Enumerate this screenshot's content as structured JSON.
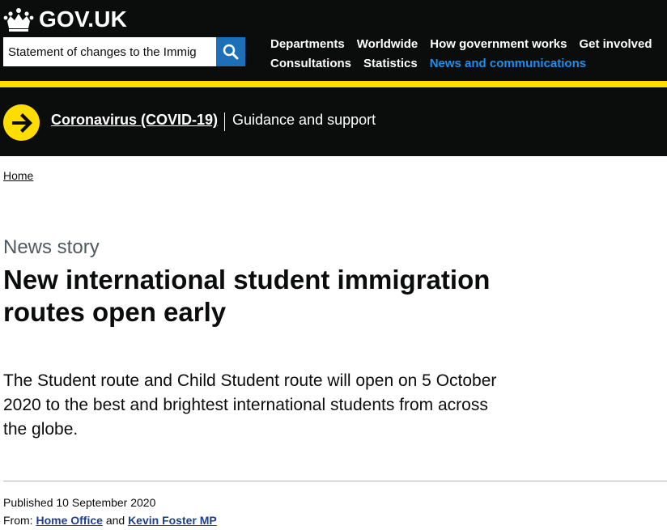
{
  "header": {
    "logo_text": "GOV.UK",
    "search": {
      "label": "Search",
      "value": "Statement of changes to the Immig"
    },
    "nav": {
      "row1": [
        "Departments",
        "Worldwide",
        "How government works",
        "Get involved"
      ],
      "row2": [
        "Consultations",
        "Statistics",
        "News and communications"
      ]
    }
  },
  "covid_banner": {
    "link": "Coronavirus (COVID-19)",
    "text": "Guidance and support"
  },
  "breadcrumb": {
    "home": "Home"
  },
  "article": {
    "caption": "News story",
    "title": "New international student immigration routes open early",
    "lead": "The Student route and Child Student route will open on 5 October 2020 to the best and brightest international students from across the globe.",
    "published_label": "Published",
    "published_date": "10 September 2020",
    "from_label": "From:",
    "from_org1": "Home Office",
    "from_and": "and",
    "from_org2": "Kevin Foster MP"
  },
  "colors": {
    "header_bg": "#0b0c0c",
    "accent_yellow": "#ffdd00",
    "link_blue": "#1d70b8",
    "active_nav": "#1d8feb"
  },
  "icons": [
    "crown-icon",
    "search-icon",
    "arrow-right-icon"
  ]
}
